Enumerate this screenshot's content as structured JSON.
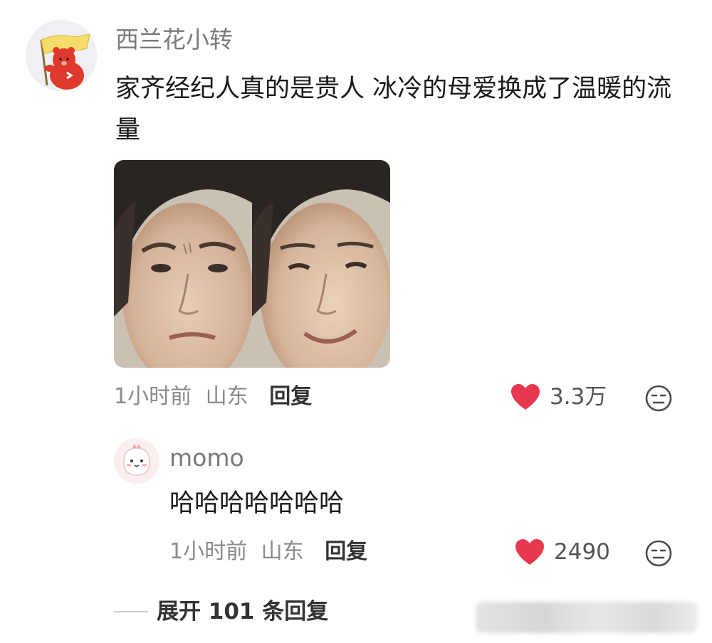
{
  "comment": {
    "username": "西兰花小转",
    "text": "家齐经纪人真的是贵人 冰冷的母爱换成了温暖的流量",
    "time": "1小时前",
    "location": "山东",
    "reply_label": "回复",
    "likes": "3.3万",
    "images": [
      {
        "name": "frowning-face-photo"
      },
      {
        "name": "smiling-face-photo"
      }
    ]
  },
  "reply": {
    "username": "momo",
    "text": "哈哈哈哈哈哈哈",
    "time": "1小时前",
    "location": "山东",
    "reply_label": "回复",
    "likes": "2490"
  },
  "expand": {
    "label": "展开 101 条回复"
  },
  "colors": {
    "like_heart": "#e8384f",
    "username": "#7a7a7a",
    "meta": "#8a8a8a"
  },
  "icons": {
    "like": "heart-icon",
    "reaction": "neutral-face-icon"
  }
}
